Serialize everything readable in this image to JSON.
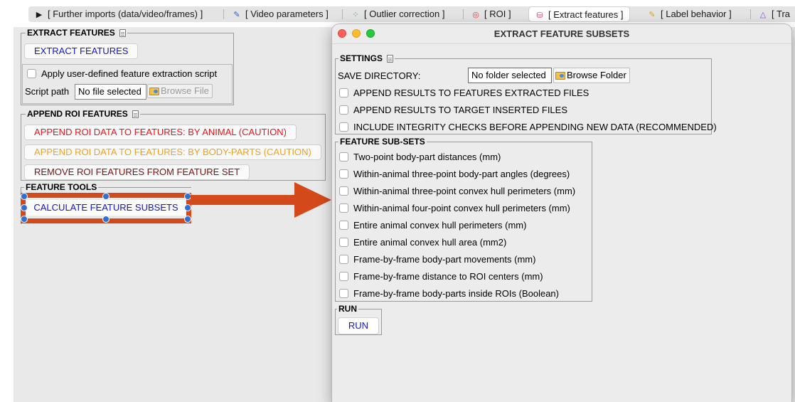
{
  "tabs": [
    {
      "label": "[ Further imports (data/video/frames) ]",
      "icon": "video-camera-icon"
    },
    {
      "label": "[ Video parameters ]",
      "icon": "ruler-pen-icon"
    },
    {
      "label": "[ Outlier correction ]",
      "icon": "scatter-points-icon"
    },
    {
      "label": "[ ROI ]",
      "icon": "roi-target-icon"
    },
    {
      "label": "[ Extract features ]",
      "icon": "database-icon"
    },
    {
      "label": "[ Label behavior ]",
      "icon": "label-tag-icon"
    },
    {
      "label": "[ Tra",
      "icon": "network-triangle-icon"
    }
  ],
  "extract_features": {
    "title": "EXTRACT FEATURES",
    "button": "EXTRACT FEATURES",
    "apply_script_label": "Apply user-defined feature extraction script",
    "script_path_label": "Script path",
    "script_path_value": "No file selected",
    "browse_file": "Browse File"
  },
  "append_roi": {
    "title": "APPEND ROI FEATURES",
    "by_animal": "APPEND ROI DATA TO FEATURES: BY ANIMAL (CAUTION)",
    "by_bodyparts": "APPEND ROI DATA TO FEATURES: BY BODY-PARTS (CAUTION)",
    "remove": "REMOVE ROI FEATURES FROM FEATURE SET"
  },
  "feature_tools": {
    "title": "FEATURE TOOLS",
    "calculate": "CALCULATE FEATURE SUBSETS"
  },
  "colors": {
    "highlight_arrow": "#d4491a",
    "handle": "#2f6fd6",
    "blue_text": "#1515c8",
    "red_text": "#e8141c",
    "orange_text": "#f0a020",
    "maroon_text": "#7a1010"
  },
  "popup": {
    "title": "EXTRACT FEATURE SUBSETS",
    "settings": {
      "title": "SETTINGS",
      "save_dir_label": "SAVE DIRECTORY:",
      "save_dir_value": "No folder selected",
      "browse_folder": "Browse Folder",
      "options": [
        "APPEND RESULTS TO FEATURES EXTRACTED FILES",
        "APPEND RESULTS TO TARGET INSERTED FILES",
        "INCLUDE INTEGRITY CHECKS BEFORE APPENDING NEW DATA (RECOMMENDED)"
      ]
    },
    "subsets": {
      "title": "FEATURE SUB-SETS",
      "items": [
        "Two-point body-part distances (mm)",
        "Within-animal three-point body-part angles (degrees)",
        "Within-animal three-point convex hull perimeters (mm)",
        "Within-animal four-point convex hull perimeters (mm)",
        "Entire animal convex hull perimeters (mm)",
        "Entire animal convex hull area (mm2)",
        "Frame-by-frame body-part movements (mm)",
        "Frame-by-frame distance to ROI centers (mm)",
        "Frame-by-frame body-parts inside ROIs (Boolean)"
      ]
    },
    "run": {
      "title": "RUN",
      "button": "RUN"
    }
  }
}
